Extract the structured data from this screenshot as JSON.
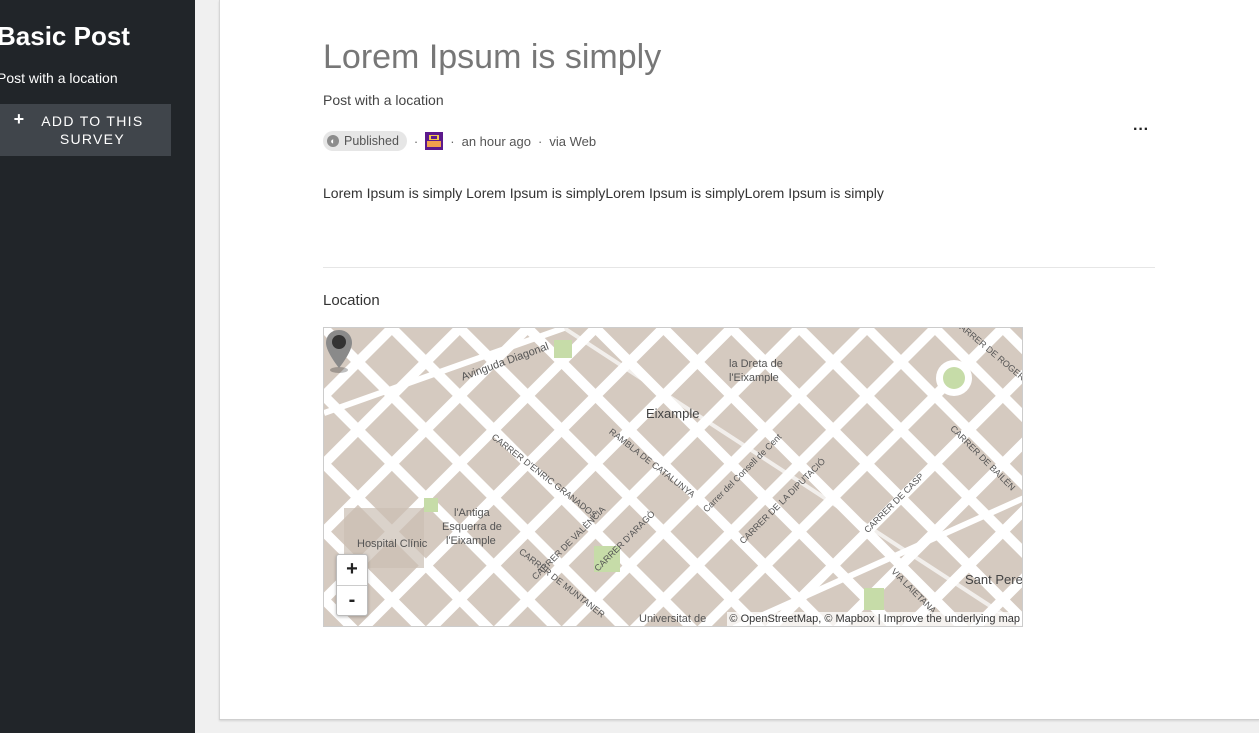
{
  "sidebar": {
    "title": "Basic Post",
    "subtitle": "Post with a location",
    "add_button": {
      "icon": "plus-icon",
      "label": "ADD TO THIS SURVEY"
    }
  },
  "post": {
    "title": "Lorem Ipsum is simply",
    "subtitle": "Post with a location",
    "status": "Published",
    "time": "an hour ago",
    "source": "via Web",
    "separator": "·",
    "more": "···",
    "body": "Lorem Ipsum is simply Lorem Ipsum is simplyLorem Ipsum is simplyLorem Ipsum is simply"
  },
  "location": {
    "label": "Location",
    "map": {
      "zoom_in": "+",
      "zoom_out": "-",
      "attribution_osm": "© OpenStreetMap, © Mapbox",
      "attribution_sep": "|",
      "attribution_improve": "Improve the underlying map",
      "labels": {
        "eixample": "Eixample",
        "dreta_1": "la Dreta de",
        "dreta_2": "l'Eixample",
        "antiga_1": "l'Antiga",
        "antiga_2": "Esquerra de",
        "antiga_3": "l'Eixample",
        "hospital": "Hospital Clínic",
        "sant_pere": "Sant Pere",
        "universitat": "Universitat de",
        "diagonal": "Avinguda Diagonal",
        "rambla": "RAMBLA DE CATALUNYA",
        "granados": "CARRER D'ENRIC GRANADOS",
        "valencia": "CARRER DE VALÈNCIA",
        "arago": "CARRER D'ARAGÓ",
        "diputacio": "CARRER DE LA DIPUTACIÓ",
        "consell": "Carrer del Consell de Cent",
        "casp": "CARRER DE CASP",
        "bailen": "CARRER DE BAILÈN",
        "laietana": "VIA LAIETANA",
        "muntaner": "CARRER DE MUNTANER",
        "roger": "CARRER DE ROGER DE"
      }
    }
  },
  "colors": {
    "sidebar_bg": "#212529",
    "button_bg": "#40454b",
    "map_bg": "#d9d0c8",
    "map_block": "#d5cac0",
    "map_road": "#ffffff",
    "map_park": "#c6dca8",
    "pin": "#4a4a4a"
  }
}
